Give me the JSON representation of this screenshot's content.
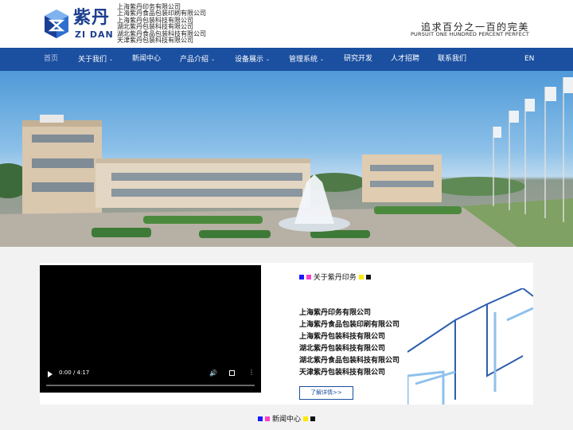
{
  "header": {
    "logo_cn": "紫丹",
    "logo_en": "ZI DAN",
    "companies": [
      "上海紫丹印务有限公司",
      "上海紫丹食品包装印刷有限公司",
      "上海紫丹包装科技有限公司",
      "湖北紫丹包装科技有限公司",
      "湖北紫丹食品包装科技有限公司",
      "天津紫丹包装科技有限公司"
    ],
    "slogan_cn": "追求百分之一百的完美",
    "slogan_en": "PURSUIT ONE HUNDRED PERCENT PERFECT"
  },
  "nav": {
    "items": [
      {
        "label": "首页",
        "active": true
      },
      {
        "label": "关于我们",
        "caret": "⌄"
      },
      {
        "label": "新闻中心"
      },
      {
        "label": "产品介绍",
        "caret": "⌄"
      },
      {
        "label": "设备展示",
        "caret": "⌄"
      },
      {
        "label": "管理系统",
        "caret": "⌄"
      },
      {
        "label": "研究开发"
      },
      {
        "label": "人才招聘"
      },
      {
        "label": "联系我们"
      }
    ],
    "lang": "EN"
  },
  "video": {
    "time": "0:00 / 4:17",
    "progress": 0
  },
  "about": {
    "title": "关于紫丹印务",
    "companies": [
      "上海紫丹印务有限公司",
      "上海紫丹食品包装印刷有限公司",
      "上海紫丹包装科技有限公司",
      "湖北紫丹包装科技有限公司",
      "湖北紫丹食品包装科技有限公司",
      "天津紫丹包装科技有限公司"
    ],
    "more": "了解详情>>"
  },
  "news": {
    "title": "新闻中心"
  },
  "colors": {
    "brand": "#1b4fa0",
    "cmyk_blue": "#1a1aff",
    "cmyk_magenta": "#ff3fc8",
    "cmyk_yellow": "#ffe800",
    "cmyk_black": "#111111"
  }
}
